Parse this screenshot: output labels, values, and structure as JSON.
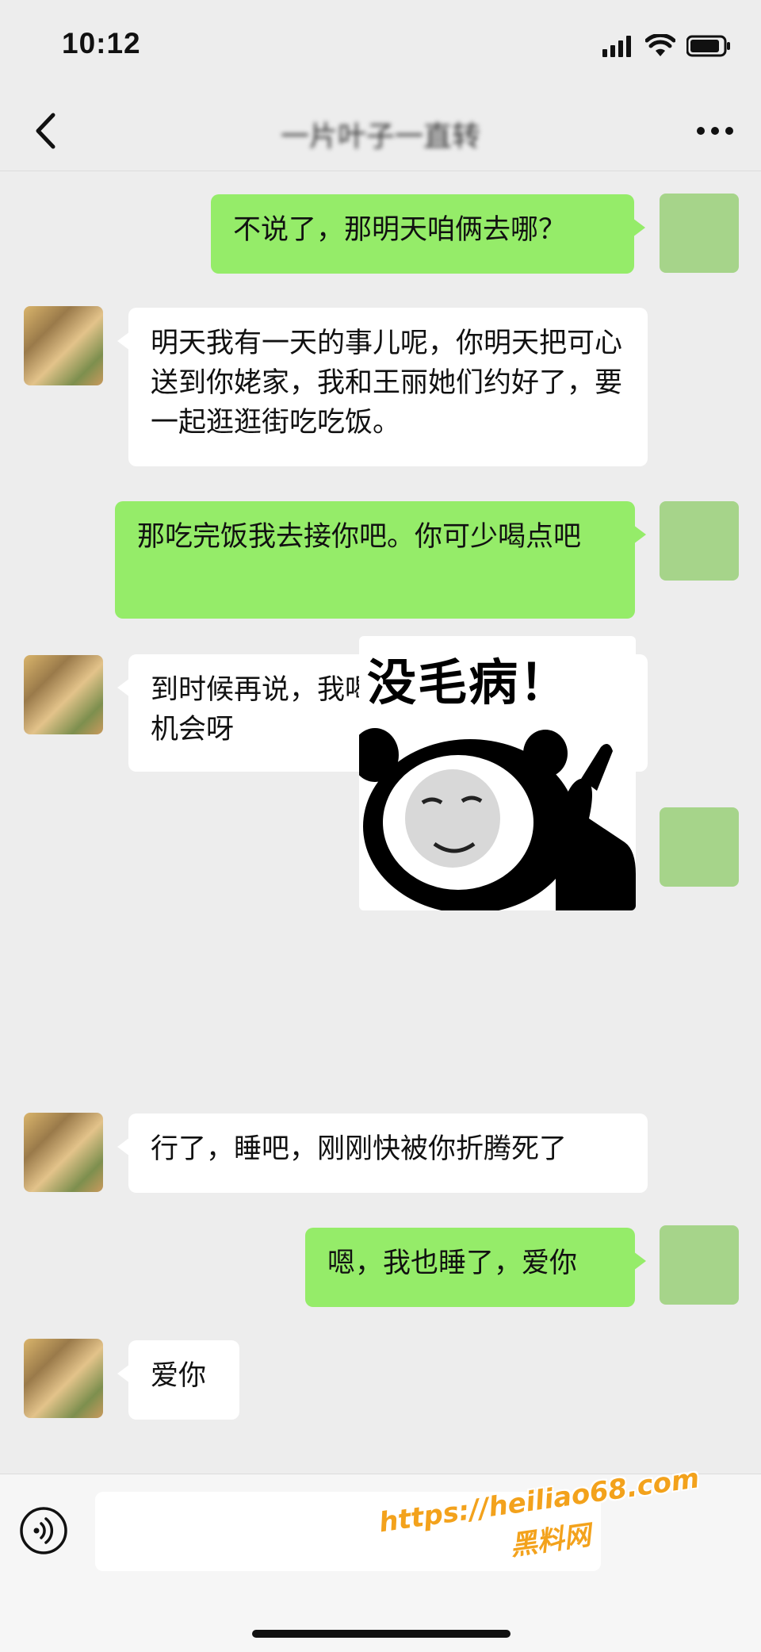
{
  "status": {
    "time": "10:12"
  },
  "header": {
    "title": "一片叶子一直转"
  },
  "messages": [
    {
      "from": "self",
      "text": "不说了，那明天咱俩去哪？"
    },
    {
      "from": "other",
      "text": "明天我有一天的事儿呢，你明天把可心送到你姥家，我和王丽她们约好了，要一起逛逛街吃吃饭。"
    },
    {
      "from": "self",
      "text": "那吃完饭我去接你吧。你可少喝点吧"
    },
    {
      "from": "other",
      "text": "到时候再说，我喝多了你这个色狼才有机会呀"
    },
    {
      "from": "self",
      "type": "sticker",
      "text": "没毛病！"
    },
    {
      "from": "other",
      "text": "行了，睡吧，刚刚快被你折腾死了"
    },
    {
      "from": "self",
      "text": "嗯，我也睡了，爱你"
    },
    {
      "from": "other",
      "text": "爱你"
    }
  ],
  "watermark": {
    "url": "https://heiliao68.com",
    "name": "黑料网"
  },
  "colors": {
    "self_bubble": "#95ec69",
    "other_bubble": "#ffffff",
    "background": "#ededed"
  }
}
